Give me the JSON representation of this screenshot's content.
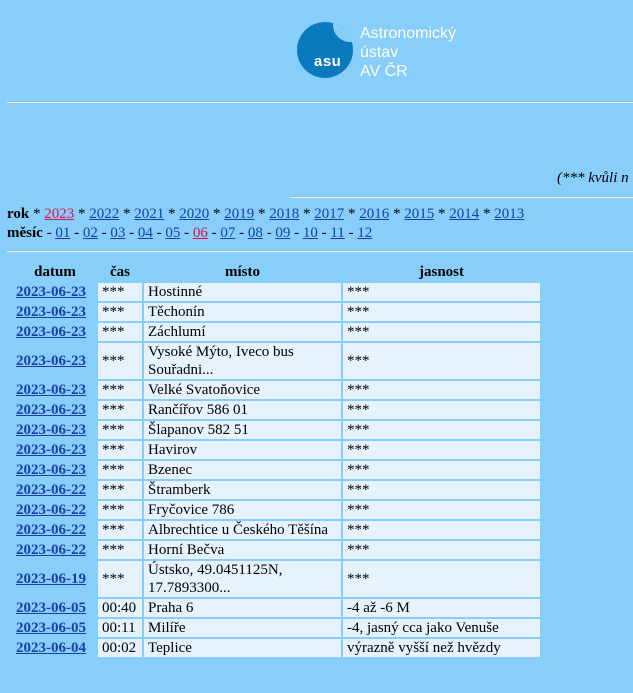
{
  "logo": {
    "abbr": "asu",
    "line1": "Astronomický",
    "line2": "ústav",
    "line3": "AV ČR"
  },
  "note": "(*** kvůli n",
  "nav": {
    "rok_label": "rok",
    "years": [
      "2023",
      "2022",
      "2021",
      "2020",
      "2019",
      "2018",
      "2017",
      "2016",
      "2015",
      "2014",
      "2013"
    ],
    "active_year": "2023",
    "mesic_label": "měsíc",
    "months": [
      "01",
      "02",
      "03",
      "04",
      "05",
      "06",
      "07",
      "08",
      "09",
      "10",
      "11",
      "12"
    ],
    "active_month": "06"
  },
  "table": {
    "headers": [
      "datum",
      "čas",
      "místo",
      "jasnost"
    ],
    "rows": [
      {
        "datum": "2023-06-23",
        "cas": "***",
        "misto": "Hostinné",
        "jasnost": "***"
      },
      {
        "datum": "2023-06-23",
        "cas": "***",
        "misto": "Těchonín",
        "jasnost": "***"
      },
      {
        "datum": "2023-06-23",
        "cas": "***",
        "misto": "Záchlumí",
        "jasnost": "***"
      },
      {
        "datum": "2023-06-23",
        "cas": "***",
        "misto": "Vysoké Mýto, Iveco bus Souřadni...",
        "jasnost": "***"
      },
      {
        "datum": "2023-06-23",
        "cas": "***",
        "misto": "Velké Svatoňovice",
        "jasnost": "***"
      },
      {
        "datum": "2023-06-23",
        "cas": "***",
        "misto": "Rančířov 586 01",
        "jasnost": "***"
      },
      {
        "datum": "2023-06-23",
        "cas": "***",
        "misto": "Šlapanov 582 51",
        "jasnost": "***"
      },
      {
        "datum": "2023-06-23",
        "cas": "***",
        "misto": "Havirov",
        "jasnost": "***"
      },
      {
        "datum": "2023-06-23",
        "cas": "***",
        "misto": "Bzenec",
        "jasnost": "***"
      },
      {
        "datum": "2023-06-22",
        "cas": "***",
        "misto": "Štramberk",
        "jasnost": "***"
      },
      {
        "datum": "2023-06-22",
        "cas": "***",
        "misto": "Fryčovice 786",
        "jasnost": "***"
      },
      {
        "datum": "2023-06-22",
        "cas": "***",
        "misto": "Albrechtice u Českého Těšína",
        "jasnost": "***"
      },
      {
        "datum": "2023-06-22",
        "cas": "***",
        "misto": "Horní Bečva",
        "jasnost": "***"
      },
      {
        "datum": "2023-06-19",
        "cas": "***",
        "misto": "Ústsko, 49.0451125N, 17.7893300...",
        "jasnost": "***"
      },
      {
        "datum": "2023-06-05",
        "cas": "00:40",
        "misto": "Praha 6",
        "jasnost": "-4 až -6 M"
      },
      {
        "datum": "2023-06-05",
        "cas": "00:11",
        "misto": "Milíře",
        "jasnost": "-4, jasný cca jako Venuše"
      },
      {
        "datum": "2023-06-04",
        "cas": "00:02",
        "misto": "Teplice",
        "jasnost": "výrazně vyšší než hvězdy"
      }
    ]
  }
}
